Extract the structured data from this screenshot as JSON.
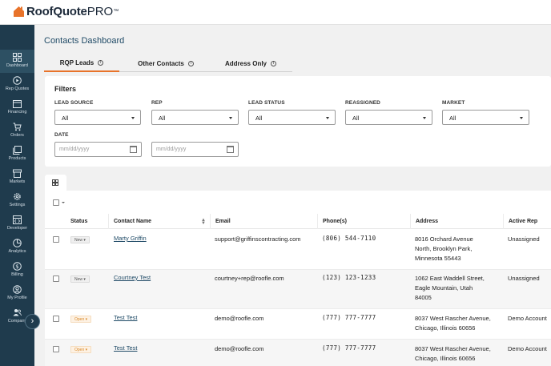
{
  "app": {
    "brand_bold": "RoofQuote",
    "brand_light": "PRO",
    "tm": "™",
    "accent": "#e8732a",
    "sidebar_bg": "#1f3b4d"
  },
  "sidebar": {
    "items": [
      {
        "label": "Dashboard",
        "icon": "dashboard-icon"
      },
      {
        "label": "Rep Quotes",
        "icon": "play-circle-icon"
      },
      {
        "label": "Financing",
        "icon": "calendar-icon"
      },
      {
        "label": "Orders",
        "icon": "cart-icon"
      },
      {
        "label": "Products",
        "icon": "products-icon"
      },
      {
        "label": "Markets",
        "icon": "store-icon"
      },
      {
        "label": "Settings",
        "icon": "gear-icon"
      },
      {
        "label": "Developer",
        "icon": "code-icon"
      },
      {
        "label": "Analytics",
        "icon": "pie-chart-icon"
      },
      {
        "label": "Billing",
        "icon": "dollar-icon"
      },
      {
        "label": "My Profile",
        "icon": "user-icon"
      },
      {
        "label": "Company",
        "icon": "team-icon"
      }
    ],
    "collapse_glyph": "›"
  },
  "page": {
    "title": "Contacts Dashboard"
  },
  "tabs": [
    {
      "label": "RQP Leads",
      "info": "i"
    },
    {
      "label": "Other Contacts",
      "info": "i"
    },
    {
      "label": "Address Only",
      "info": "i"
    }
  ],
  "filters": {
    "heading": "Filters",
    "selects": [
      {
        "label": "LEAD SOURCE",
        "value": "All"
      },
      {
        "label": "REP",
        "value": "All"
      },
      {
        "label": "LEAD STATUS",
        "value": "All"
      },
      {
        "label": "REASSIGNED",
        "value": "All"
      },
      {
        "label": "MARKET",
        "value": "All"
      }
    ],
    "date_label": "DATE",
    "date_from_placeholder": "mm/dd/yyyy",
    "date_to_placeholder": "mm/dd/yyyy",
    "date_separator": "-"
  },
  "table": {
    "columns": [
      "Status",
      "Contact Name",
      "Email",
      "Phone(s)",
      "Address",
      "Active Rep"
    ],
    "rows": [
      {
        "status": "New ▾",
        "status_type": "new",
        "name": "Marty Griffin",
        "email": "support@griffinscontracting.com",
        "phone": "(806) 544-7110",
        "address": [
          "8016 Orchard Avenue",
          "North, Brooklyn Park,",
          "Minnesota 55443"
        ],
        "rep": "Unassigned"
      },
      {
        "status": "New ▾",
        "status_type": "new",
        "name": "Courtney Test",
        "email": "courtney+rep@roofle.com",
        "phone": "(123) 123-1233",
        "address": [
          "1062 East Waddell Street,",
          "Eagle Mountain, Utah",
          "84005"
        ],
        "rep": "Unassigned"
      },
      {
        "status": "Open ▾",
        "status_type": "open",
        "name": "Test Test",
        "email": "demo@roofle.com",
        "phone": "(777) 777-7777",
        "address": [
          "8037 West Rascher Avenue,",
          "Chicago, Illinois 60656"
        ],
        "rep": "Demo Account"
      },
      {
        "status": "Open ▾",
        "status_type": "open",
        "name": "Test Test",
        "email": "demo@roofle.com",
        "phone": "(777) 777-7777",
        "address": [
          "8037 West Rascher Avenue,",
          "Chicago, Illinois 60656"
        ],
        "rep": "Demo Account"
      }
    ]
  }
}
